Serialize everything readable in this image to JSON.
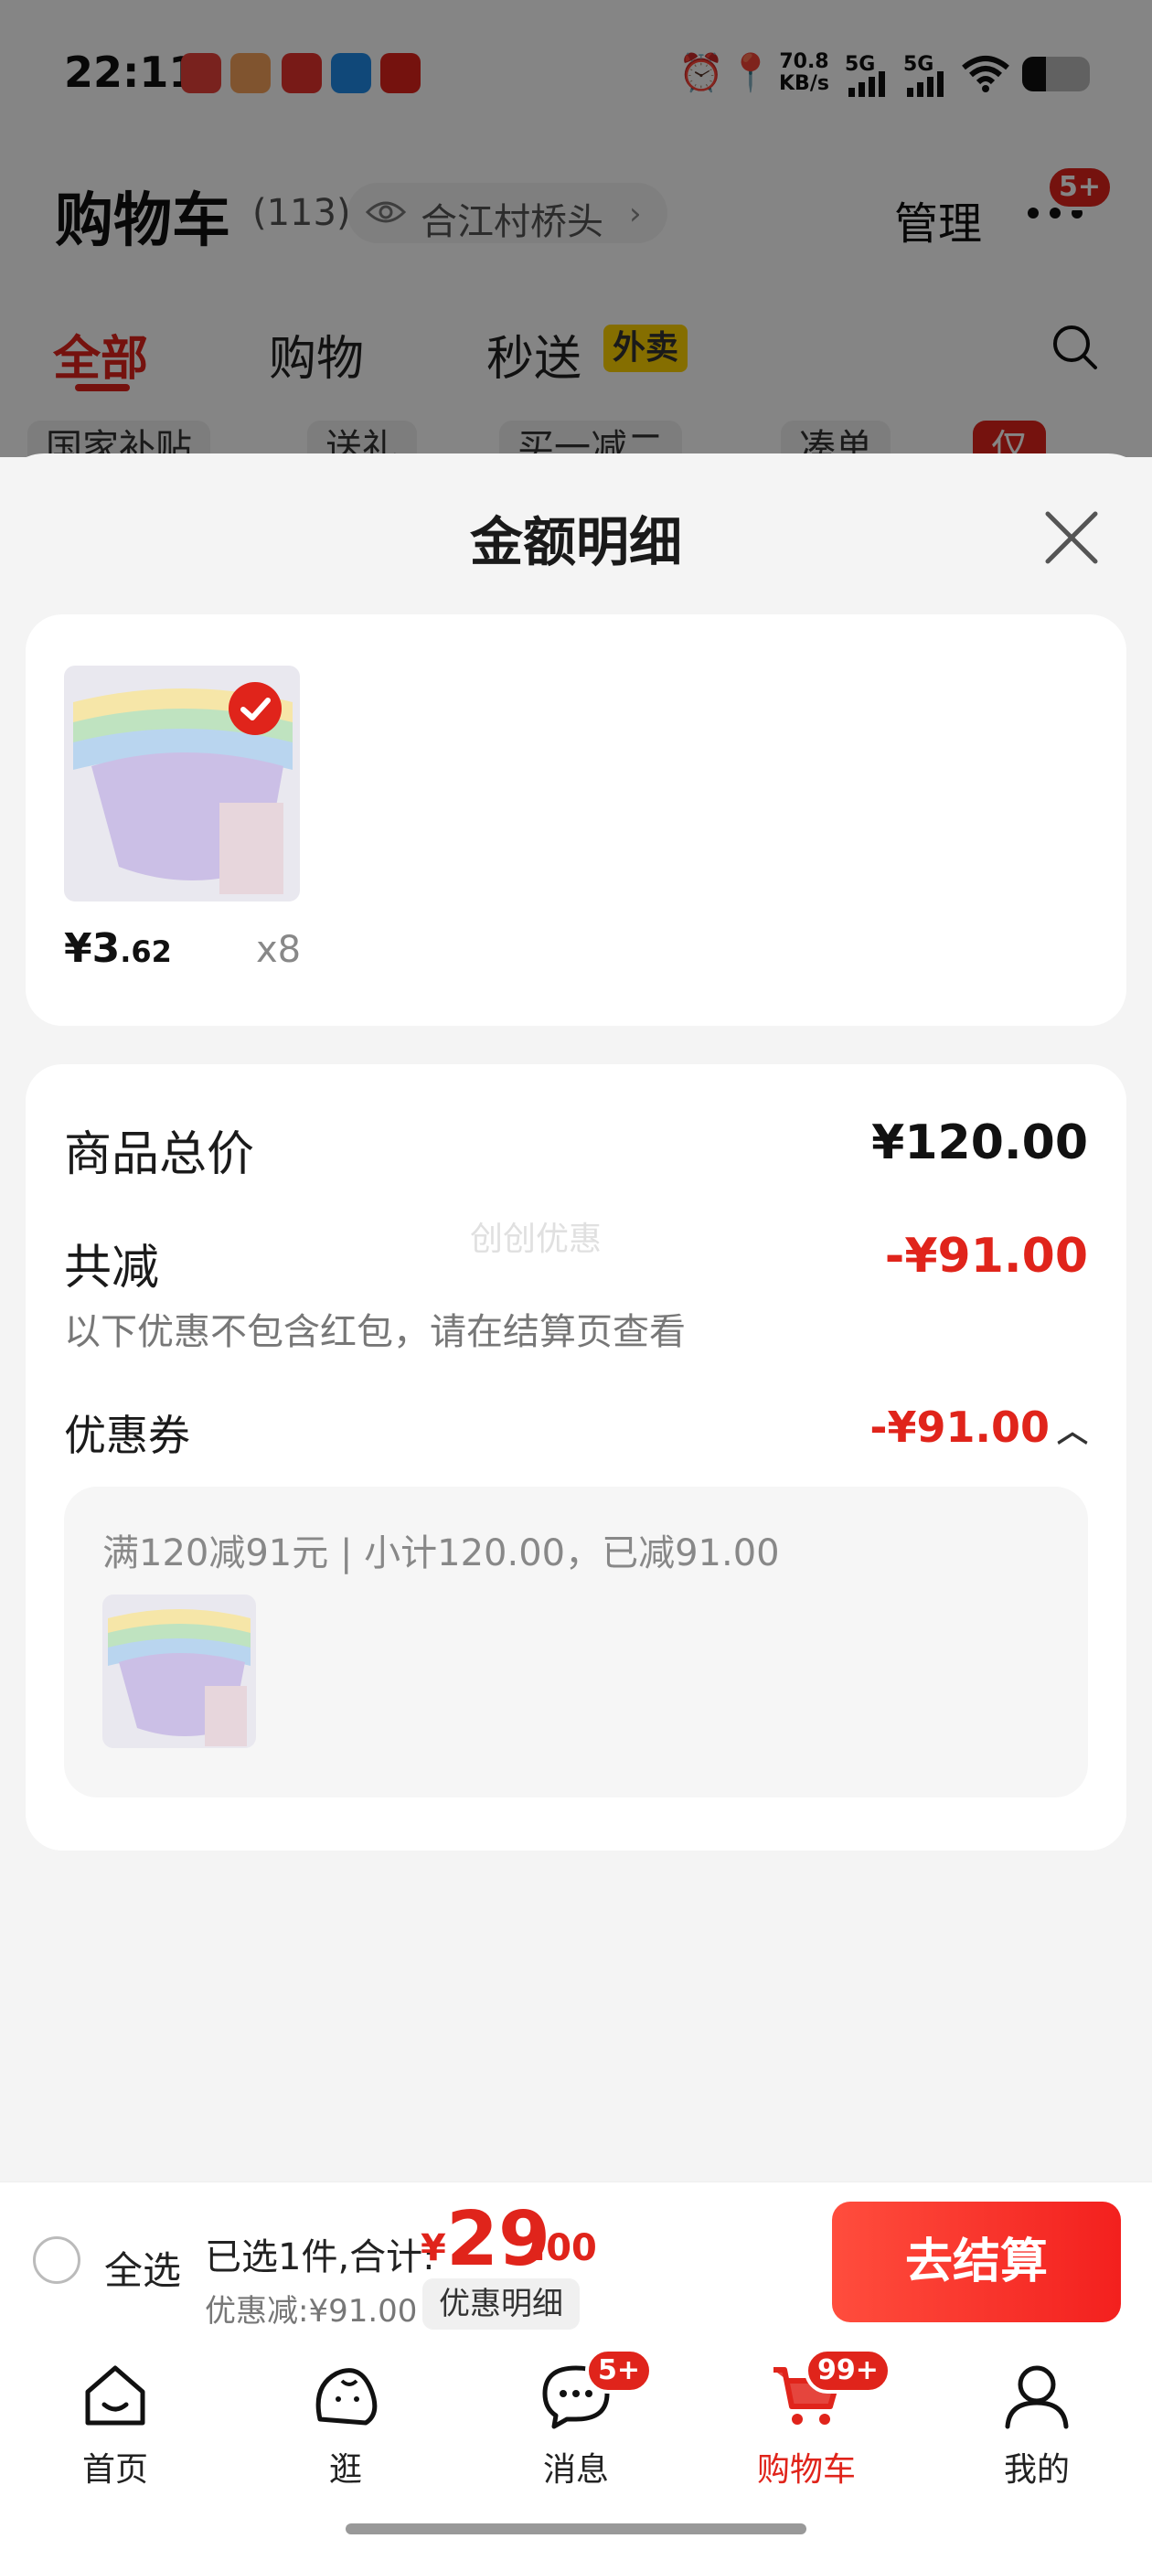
{
  "status_bar": {
    "time": "22:11",
    "net_speed": "70.8",
    "net_unit": "KB/s",
    "sig1": "5G",
    "sig2": "5G"
  },
  "header": {
    "title": "购物车",
    "count": "(113)",
    "location": "合江村桥头",
    "manage": "管理",
    "more_badge": "5+"
  },
  "tabs": [
    {
      "label": "全部"
    },
    {
      "label": "购物"
    },
    {
      "label": "秒送"
    }
  ],
  "tab_badge": "外卖",
  "chips": [
    "国家补贴",
    "送礼",
    "买一减二",
    "凑单",
    "仅"
  ],
  "sheet": {
    "title": "金额明细",
    "item": {
      "price_int": "¥3",
      "price_dec": ".62",
      "qty": "x8"
    },
    "total_label": "商品总价",
    "total_value": "¥120.00",
    "reduce_label": "共减",
    "reduce_value": "-¥91.00",
    "reduce_note": "以下优惠不包含红包，请在结算页查看",
    "watermark": "创创优惠",
    "coupon_label": "优惠券",
    "coupon_value": "-¥91.00",
    "coupon_desc": "满120减91元 | 小计120.00，已减91.00"
  },
  "bottom_bar": {
    "select_all": "全选",
    "selected_text": "已选1件,合计:",
    "currency": "¥",
    "total_int": "29",
    "total_dec": ".00",
    "discount_text": "优惠减:¥91.00",
    "detail_button": "优惠明细",
    "checkout": "去结算"
  },
  "nav": [
    {
      "label": "首页",
      "icon": "home-icon"
    },
    {
      "label": "逛",
      "icon": "browse-icon"
    },
    {
      "label": "消息",
      "icon": "message-icon",
      "badge": "5+"
    },
    {
      "label": "购物车",
      "icon": "cart-icon",
      "badge": "99+",
      "active": true
    },
    {
      "label": "我的",
      "icon": "profile-icon"
    }
  ],
  "colors": {
    "accent": "#e0241b",
    "badge_yellow": "#ffd400",
    "background": "#f4f4f4"
  }
}
